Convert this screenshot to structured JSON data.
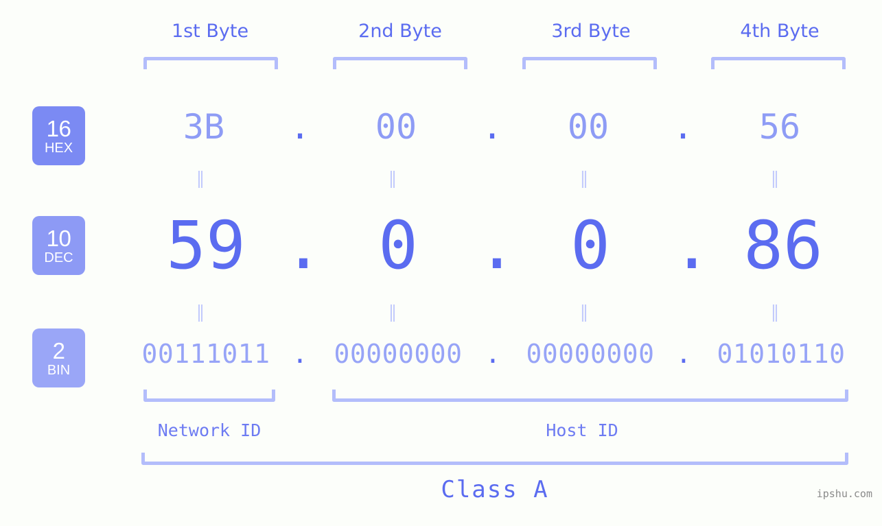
{
  "page": {
    "background": "#fcfefa",
    "accent_strong": "#5b6cf0",
    "accent_mid": "#8e9cf5",
    "accent_light": "#b3bdfb",
    "watermark": "ipshu.com"
  },
  "byte_headers": [
    {
      "label": "1st Byte"
    },
    {
      "label": "2nd Byte"
    },
    {
      "label": "3rd Byte"
    },
    {
      "label": "4th Byte"
    }
  ],
  "bases": [
    {
      "number": "16",
      "name": "HEX",
      "color": "#7b8af3"
    },
    {
      "number": "10",
      "name": "DEC",
      "color": "#8d9af5"
    },
    {
      "number": "2",
      "name": "BIN",
      "color": "#9aa6f7"
    }
  ],
  "rows": {
    "hex": {
      "values": [
        "3B",
        "00",
        "00",
        "56"
      ],
      "separator": "."
    },
    "dec": {
      "values": [
        "59",
        "0",
        "0",
        "86"
      ],
      "separator": "."
    },
    "bin": {
      "values": [
        "00111011",
        "00000000",
        "00000000",
        "01010110"
      ],
      "separator": "."
    }
  },
  "equals_marks": {
    "symbol": "‖",
    "count_per_row": 4
  },
  "id_labels": {
    "network": "Network ID",
    "host": "Host ID"
  },
  "class_label": "Class A",
  "chart_data": {
    "type": "table",
    "title": "IPv4 address byte breakdown",
    "categories": [
      "1st Byte",
      "2nd Byte",
      "3rd Byte",
      "4th Byte"
    ],
    "series": [
      {
        "name": "HEX (base 16)",
        "values": [
          "3B",
          "00",
          "00",
          "56"
        ]
      },
      {
        "name": "DEC (base 10)",
        "values": [
          "59",
          "0",
          "0",
          "86"
        ]
      },
      {
        "name": "BIN (base 2)",
        "values": [
          "00111011",
          "00000000",
          "00000000",
          "01010110"
        ]
      }
    ],
    "annotations": [
      "Network ID",
      "Host ID",
      "Class A"
    ],
    "xlabel": "",
    "ylabel": ""
  }
}
